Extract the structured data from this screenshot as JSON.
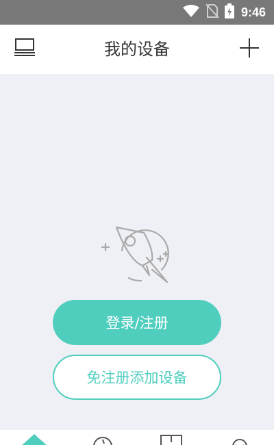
{
  "status_bar": {
    "time": "9:46",
    "icons": [
      "wifi-icon",
      "no-sim-icon",
      "battery-charging-icon"
    ]
  },
  "header": {
    "title": "我的设备",
    "left_icon": "device-list-icon",
    "right_icon": "add-icon"
  },
  "empty_state": {
    "illustration": "rocket-icon"
  },
  "actions": {
    "login_register_label": "登录/注册",
    "add_without_register_label": "免注册添加设备"
  },
  "bottom_nav": {
    "items": [
      "home-icon",
      "clock-icon",
      "book-icon",
      "profile-icon"
    ],
    "active": "home-icon"
  },
  "colors": {
    "accent": "#4fcebe",
    "background": "#eff0f5",
    "status_bar": "#787878",
    "icon_gray": "#a9a9a9"
  }
}
